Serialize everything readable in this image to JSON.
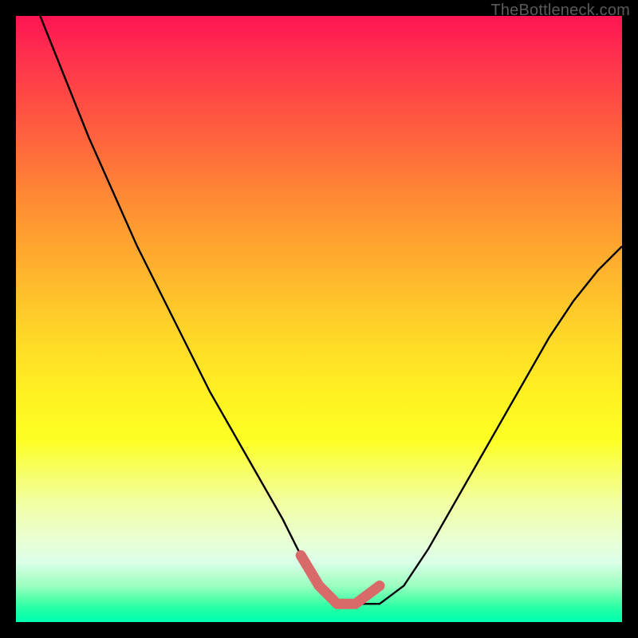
{
  "watermark": {
    "text": "TheBottleneck.com"
  },
  "colors": {
    "curve": "#000000",
    "highlight": "#d86a6a",
    "highlight_stroke": "#d86a6a"
  },
  "chart_data": {
    "type": "line",
    "title": "",
    "xlabel": "",
    "ylabel": "",
    "xlim": [
      0,
      100
    ],
    "ylim": [
      0,
      100
    ],
    "grid": false,
    "legend": false,
    "series": [
      {
        "name": "bottleneck-curve",
        "x": [
          4,
          8,
          12,
          16,
          20,
          24,
          28,
          32,
          36,
          40,
          44,
          47,
          50,
          53,
          56,
          60,
          64,
          68,
          72,
          76,
          80,
          84,
          88,
          92,
          96,
          100
        ],
        "y": [
          100,
          90,
          80,
          71,
          62,
          54,
          46,
          38,
          31,
          24,
          17,
          11,
          6,
          3,
          3,
          3,
          6,
          12,
          19,
          26,
          33,
          40,
          47,
          53,
          58,
          62
        ]
      }
    ],
    "highlight_segment": {
      "name": "optimal-zone",
      "x": [
        47,
        50,
        53,
        56,
        60
      ],
      "y": [
        11,
        6,
        3,
        3,
        6
      ]
    }
  }
}
